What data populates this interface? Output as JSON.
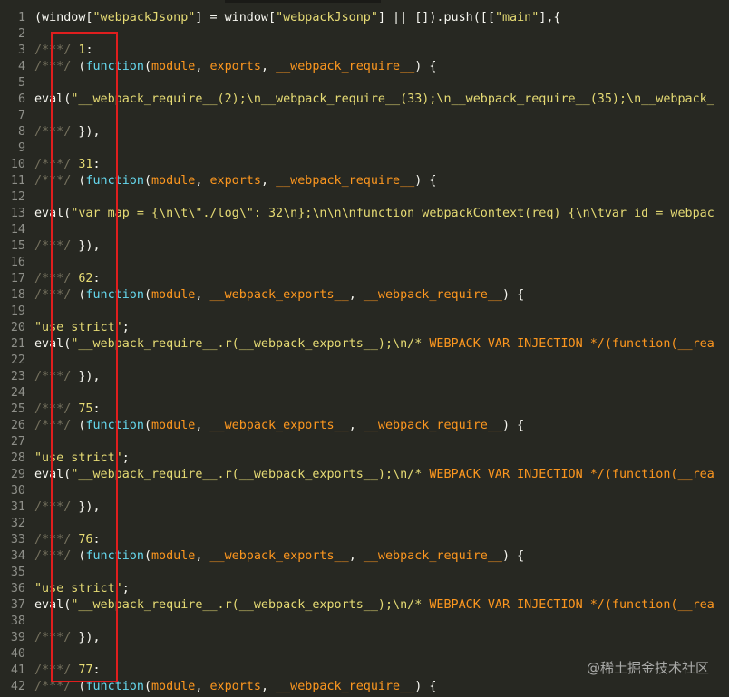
{
  "editor": {
    "lines": [
      {
        "n": "1",
        "tokens": [
          [
            "(window[",
            "plain"
          ],
          [
            "\"webpackJsonp\"",
            "str"
          ],
          [
            "] = window[",
            "plain"
          ],
          [
            "\"webpackJsonp\"",
            "str"
          ],
          [
            "] || []).push([[",
            "plain"
          ],
          [
            "\"main\"",
            "str"
          ],
          [
            "],{",
            "plain"
          ]
        ]
      },
      {
        "n": "2",
        "tokens": []
      },
      {
        "n": "3",
        "tokens": [
          [
            "/***/ ",
            "comment"
          ],
          [
            "1",
            "num"
          ],
          [
            ":",
            "plain"
          ]
        ]
      },
      {
        "n": "4",
        "tokens": [
          [
            "/***/ ",
            "comment"
          ],
          [
            "(",
            "plain"
          ],
          [
            "function",
            "kw"
          ],
          [
            "(",
            "plain"
          ],
          [
            "module",
            "param"
          ],
          [
            ", ",
            "plain"
          ],
          [
            "exports",
            "param"
          ],
          [
            ", ",
            "plain"
          ],
          [
            "__webpack_require__",
            "param"
          ],
          [
            ") {",
            "plain"
          ]
        ]
      },
      {
        "n": "5",
        "tokens": []
      },
      {
        "n": "6",
        "tokens": [
          [
            "eval(",
            "plain"
          ],
          [
            "\"__webpack_require__(2);\\n__webpack_require__(33);\\n__webpack_require__(35);\\n__webpack_",
            "str"
          ]
        ]
      },
      {
        "n": "7",
        "tokens": []
      },
      {
        "n": "8",
        "tokens": [
          [
            "/***/ ",
            "comment"
          ],
          [
            "}),",
            "plain"
          ]
        ]
      },
      {
        "n": "9",
        "tokens": []
      },
      {
        "n": "10",
        "tokens": [
          [
            "/***/ ",
            "comment"
          ],
          [
            "31",
            "num"
          ],
          [
            ":",
            "plain"
          ]
        ]
      },
      {
        "n": "11",
        "tokens": [
          [
            "/***/ ",
            "comment"
          ],
          [
            "(",
            "plain"
          ],
          [
            "function",
            "kw"
          ],
          [
            "(",
            "plain"
          ],
          [
            "module",
            "param"
          ],
          [
            ", ",
            "plain"
          ],
          [
            "exports",
            "param"
          ],
          [
            ", ",
            "plain"
          ],
          [
            "__webpack_require__",
            "param"
          ],
          [
            ") {",
            "plain"
          ]
        ]
      },
      {
        "n": "12",
        "tokens": []
      },
      {
        "n": "13",
        "tokens": [
          [
            "eval(",
            "plain"
          ],
          [
            "\"var map = {\\n\\t\\\"./log\\\": 32\\n};\\n\\n\\nfunction webpackContext(req) {\\n\\tvar id = webpac",
            "str"
          ]
        ]
      },
      {
        "n": "14",
        "tokens": []
      },
      {
        "n": "15",
        "tokens": [
          [
            "/***/ ",
            "comment"
          ],
          [
            "}),",
            "plain"
          ]
        ]
      },
      {
        "n": "16",
        "tokens": []
      },
      {
        "n": "17",
        "tokens": [
          [
            "/***/ ",
            "comment"
          ],
          [
            "62",
            "num"
          ],
          [
            ":",
            "plain"
          ]
        ]
      },
      {
        "n": "18",
        "tokens": [
          [
            "/***/ ",
            "comment"
          ],
          [
            "(",
            "plain"
          ],
          [
            "function",
            "kw"
          ],
          [
            "(",
            "plain"
          ],
          [
            "module",
            "param"
          ],
          [
            ", ",
            "plain"
          ],
          [
            "__webpack_exports__",
            "param"
          ],
          [
            ", ",
            "plain"
          ],
          [
            "__webpack_require__",
            "param"
          ],
          [
            ") {",
            "plain"
          ]
        ]
      },
      {
        "n": "19",
        "tokens": []
      },
      {
        "n": "20",
        "tokens": [
          [
            "\"use strict\"",
            "str"
          ],
          [
            ";",
            "plain"
          ]
        ]
      },
      {
        "n": "21",
        "tokens": [
          [
            "eval(",
            "plain"
          ],
          [
            "\"__webpack_require__.r(__webpack_exports__);\\n/* ",
            "str"
          ],
          [
            "WEBPACK VAR INJECTION */(function(__rea",
            "strong"
          ]
        ]
      },
      {
        "n": "22",
        "tokens": []
      },
      {
        "n": "23",
        "tokens": [
          [
            "/***/ ",
            "comment"
          ],
          [
            "}),",
            "plain"
          ]
        ]
      },
      {
        "n": "24",
        "tokens": []
      },
      {
        "n": "25",
        "tokens": [
          [
            "/***/ ",
            "comment"
          ],
          [
            "75",
            "num"
          ],
          [
            ":",
            "plain"
          ]
        ]
      },
      {
        "n": "26",
        "tokens": [
          [
            "/***/ ",
            "comment"
          ],
          [
            "(",
            "plain"
          ],
          [
            "function",
            "kw"
          ],
          [
            "(",
            "plain"
          ],
          [
            "module",
            "param"
          ],
          [
            ", ",
            "plain"
          ],
          [
            "__webpack_exports__",
            "param"
          ],
          [
            ", ",
            "plain"
          ],
          [
            "__webpack_require__",
            "param"
          ],
          [
            ") {",
            "plain"
          ]
        ]
      },
      {
        "n": "27",
        "tokens": []
      },
      {
        "n": "28",
        "tokens": [
          [
            "\"use strict\"",
            "str"
          ],
          [
            ";",
            "plain"
          ]
        ]
      },
      {
        "n": "29",
        "tokens": [
          [
            "eval(",
            "plain"
          ],
          [
            "\"__webpack_require__.r(__webpack_exports__);\\n/* ",
            "str"
          ],
          [
            "WEBPACK VAR INJECTION */(function(__rea",
            "strong"
          ]
        ]
      },
      {
        "n": "30",
        "tokens": []
      },
      {
        "n": "31",
        "tokens": [
          [
            "/***/ ",
            "comment"
          ],
          [
            "}),",
            "plain"
          ]
        ]
      },
      {
        "n": "32",
        "tokens": []
      },
      {
        "n": "33",
        "tokens": [
          [
            "/***/ ",
            "comment"
          ],
          [
            "76",
            "num"
          ],
          [
            ":",
            "plain"
          ]
        ]
      },
      {
        "n": "34",
        "tokens": [
          [
            "/***/ ",
            "comment"
          ],
          [
            "(",
            "plain"
          ],
          [
            "function",
            "kw"
          ],
          [
            "(",
            "plain"
          ],
          [
            "module",
            "param"
          ],
          [
            ", ",
            "plain"
          ],
          [
            "__webpack_exports__",
            "param"
          ],
          [
            ", ",
            "plain"
          ],
          [
            "__webpack_require__",
            "param"
          ],
          [
            ") {",
            "plain"
          ]
        ]
      },
      {
        "n": "35",
        "tokens": []
      },
      {
        "n": "36",
        "tokens": [
          [
            "\"use strict\"",
            "str"
          ],
          [
            ";",
            "plain"
          ]
        ]
      },
      {
        "n": "37",
        "tokens": [
          [
            "eval(",
            "plain"
          ],
          [
            "\"__webpack_require__.r(__webpack_exports__);\\n/* ",
            "str"
          ],
          [
            "WEBPACK VAR INJECTION */(function(__rea",
            "strong"
          ]
        ]
      },
      {
        "n": "38",
        "tokens": []
      },
      {
        "n": "39",
        "tokens": [
          [
            "/***/ ",
            "comment"
          ],
          [
            "}),",
            "plain"
          ]
        ]
      },
      {
        "n": "40",
        "tokens": []
      },
      {
        "n": "41",
        "tokens": [
          [
            "/***/ ",
            "comment"
          ],
          [
            "77",
            "num"
          ],
          [
            ":",
            "plain"
          ]
        ]
      },
      {
        "n": "42",
        "tokens": [
          [
            "/***/ ",
            "comment"
          ],
          [
            "(",
            "plain"
          ],
          [
            "function",
            "kw"
          ],
          [
            "(",
            "plain"
          ],
          [
            "module",
            "param"
          ],
          [
            ", ",
            "plain"
          ],
          [
            "exports",
            "param"
          ],
          [
            ", ",
            "plain"
          ],
          [
            "__webpack_require__",
            "param"
          ],
          [
            ") {",
            "plain"
          ]
        ]
      }
    ]
  },
  "watermark": "@稀土掘金技术社区",
  "colors": {
    "background": "#272822",
    "string": "#e6db74",
    "comment": "#75715e",
    "keyword": "#66d9ef",
    "param": "#fd971f",
    "highlight_box": "#e01e1e"
  }
}
